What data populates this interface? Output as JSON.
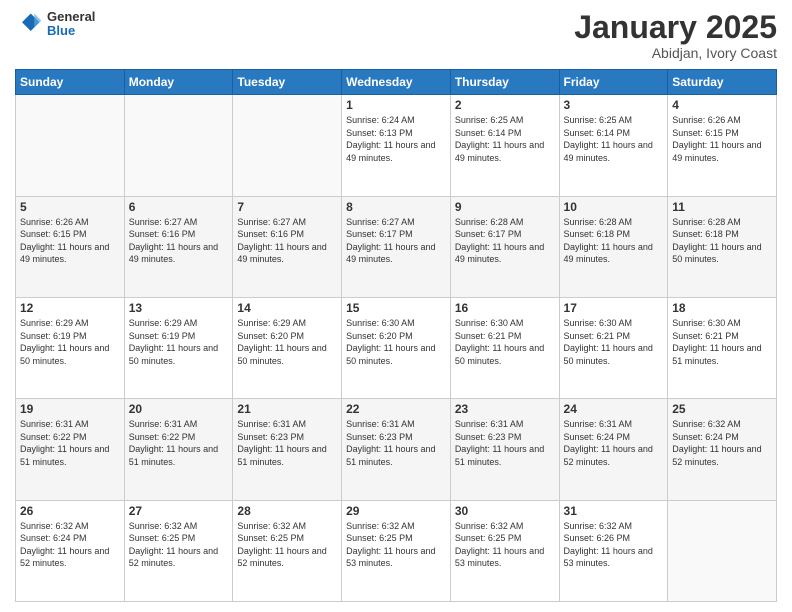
{
  "header": {
    "logo_line1": "General",
    "logo_line2": "Blue",
    "month_title": "January 2025",
    "location": "Abidjan, Ivory Coast"
  },
  "days_of_week": [
    "Sunday",
    "Monday",
    "Tuesday",
    "Wednesday",
    "Thursday",
    "Friday",
    "Saturday"
  ],
  "weeks": [
    [
      {
        "day": "",
        "sunrise": "",
        "sunset": "",
        "daylight": ""
      },
      {
        "day": "",
        "sunrise": "",
        "sunset": "",
        "daylight": ""
      },
      {
        "day": "",
        "sunrise": "",
        "sunset": "",
        "daylight": ""
      },
      {
        "day": "1",
        "sunrise": "Sunrise: 6:24 AM",
        "sunset": "Sunset: 6:13 PM",
        "daylight": "Daylight: 11 hours and 49 minutes."
      },
      {
        "day": "2",
        "sunrise": "Sunrise: 6:25 AM",
        "sunset": "Sunset: 6:14 PM",
        "daylight": "Daylight: 11 hours and 49 minutes."
      },
      {
        "day": "3",
        "sunrise": "Sunrise: 6:25 AM",
        "sunset": "Sunset: 6:14 PM",
        "daylight": "Daylight: 11 hours and 49 minutes."
      },
      {
        "day": "4",
        "sunrise": "Sunrise: 6:26 AM",
        "sunset": "Sunset: 6:15 PM",
        "daylight": "Daylight: 11 hours and 49 minutes."
      }
    ],
    [
      {
        "day": "5",
        "sunrise": "Sunrise: 6:26 AM",
        "sunset": "Sunset: 6:15 PM",
        "daylight": "Daylight: 11 hours and 49 minutes."
      },
      {
        "day": "6",
        "sunrise": "Sunrise: 6:27 AM",
        "sunset": "Sunset: 6:16 PM",
        "daylight": "Daylight: 11 hours and 49 minutes."
      },
      {
        "day": "7",
        "sunrise": "Sunrise: 6:27 AM",
        "sunset": "Sunset: 6:16 PM",
        "daylight": "Daylight: 11 hours and 49 minutes."
      },
      {
        "day": "8",
        "sunrise": "Sunrise: 6:27 AM",
        "sunset": "Sunset: 6:17 PM",
        "daylight": "Daylight: 11 hours and 49 minutes."
      },
      {
        "day": "9",
        "sunrise": "Sunrise: 6:28 AM",
        "sunset": "Sunset: 6:17 PM",
        "daylight": "Daylight: 11 hours and 49 minutes."
      },
      {
        "day": "10",
        "sunrise": "Sunrise: 6:28 AM",
        "sunset": "Sunset: 6:18 PM",
        "daylight": "Daylight: 11 hours and 49 minutes."
      },
      {
        "day": "11",
        "sunrise": "Sunrise: 6:28 AM",
        "sunset": "Sunset: 6:18 PM",
        "daylight": "Daylight: 11 hours and 50 minutes."
      }
    ],
    [
      {
        "day": "12",
        "sunrise": "Sunrise: 6:29 AM",
        "sunset": "Sunset: 6:19 PM",
        "daylight": "Daylight: 11 hours and 50 minutes."
      },
      {
        "day": "13",
        "sunrise": "Sunrise: 6:29 AM",
        "sunset": "Sunset: 6:19 PM",
        "daylight": "Daylight: 11 hours and 50 minutes."
      },
      {
        "day": "14",
        "sunrise": "Sunrise: 6:29 AM",
        "sunset": "Sunset: 6:20 PM",
        "daylight": "Daylight: 11 hours and 50 minutes."
      },
      {
        "day": "15",
        "sunrise": "Sunrise: 6:30 AM",
        "sunset": "Sunset: 6:20 PM",
        "daylight": "Daylight: 11 hours and 50 minutes."
      },
      {
        "day": "16",
        "sunrise": "Sunrise: 6:30 AM",
        "sunset": "Sunset: 6:21 PM",
        "daylight": "Daylight: 11 hours and 50 minutes."
      },
      {
        "day": "17",
        "sunrise": "Sunrise: 6:30 AM",
        "sunset": "Sunset: 6:21 PM",
        "daylight": "Daylight: 11 hours and 50 minutes."
      },
      {
        "day": "18",
        "sunrise": "Sunrise: 6:30 AM",
        "sunset": "Sunset: 6:21 PM",
        "daylight": "Daylight: 11 hours and 51 minutes."
      }
    ],
    [
      {
        "day": "19",
        "sunrise": "Sunrise: 6:31 AM",
        "sunset": "Sunset: 6:22 PM",
        "daylight": "Daylight: 11 hours and 51 minutes."
      },
      {
        "day": "20",
        "sunrise": "Sunrise: 6:31 AM",
        "sunset": "Sunset: 6:22 PM",
        "daylight": "Daylight: 11 hours and 51 minutes."
      },
      {
        "day": "21",
        "sunrise": "Sunrise: 6:31 AM",
        "sunset": "Sunset: 6:23 PM",
        "daylight": "Daylight: 11 hours and 51 minutes."
      },
      {
        "day": "22",
        "sunrise": "Sunrise: 6:31 AM",
        "sunset": "Sunset: 6:23 PM",
        "daylight": "Daylight: 11 hours and 51 minutes."
      },
      {
        "day": "23",
        "sunrise": "Sunrise: 6:31 AM",
        "sunset": "Sunset: 6:23 PM",
        "daylight": "Daylight: 11 hours and 51 minutes."
      },
      {
        "day": "24",
        "sunrise": "Sunrise: 6:31 AM",
        "sunset": "Sunset: 6:24 PM",
        "daylight": "Daylight: 11 hours and 52 minutes."
      },
      {
        "day": "25",
        "sunrise": "Sunrise: 6:32 AM",
        "sunset": "Sunset: 6:24 PM",
        "daylight": "Daylight: 11 hours and 52 minutes."
      }
    ],
    [
      {
        "day": "26",
        "sunrise": "Sunrise: 6:32 AM",
        "sunset": "Sunset: 6:24 PM",
        "daylight": "Daylight: 11 hours and 52 minutes."
      },
      {
        "day": "27",
        "sunrise": "Sunrise: 6:32 AM",
        "sunset": "Sunset: 6:25 PM",
        "daylight": "Daylight: 11 hours and 52 minutes."
      },
      {
        "day": "28",
        "sunrise": "Sunrise: 6:32 AM",
        "sunset": "Sunset: 6:25 PM",
        "daylight": "Daylight: 11 hours and 52 minutes."
      },
      {
        "day": "29",
        "sunrise": "Sunrise: 6:32 AM",
        "sunset": "Sunset: 6:25 PM",
        "daylight": "Daylight: 11 hours and 53 minutes."
      },
      {
        "day": "30",
        "sunrise": "Sunrise: 6:32 AM",
        "sunset": "Sunset: 6:25 PM",
        "daylight": "Daylight: 11 hours and 53 minutes."
      },
      {
        "day": "31",
        "sunrise": "Sunrise: 6:32 AM",
        "sunset": "Sunset: 6:26 PM",
        "daylight": "Daylight: 11 hours and 53 minutes."
      },
      {
        "day": "",
        "sunrise": "",
        "sunset": "",
        "daylight": ""
      }
    ]
  ]
}
